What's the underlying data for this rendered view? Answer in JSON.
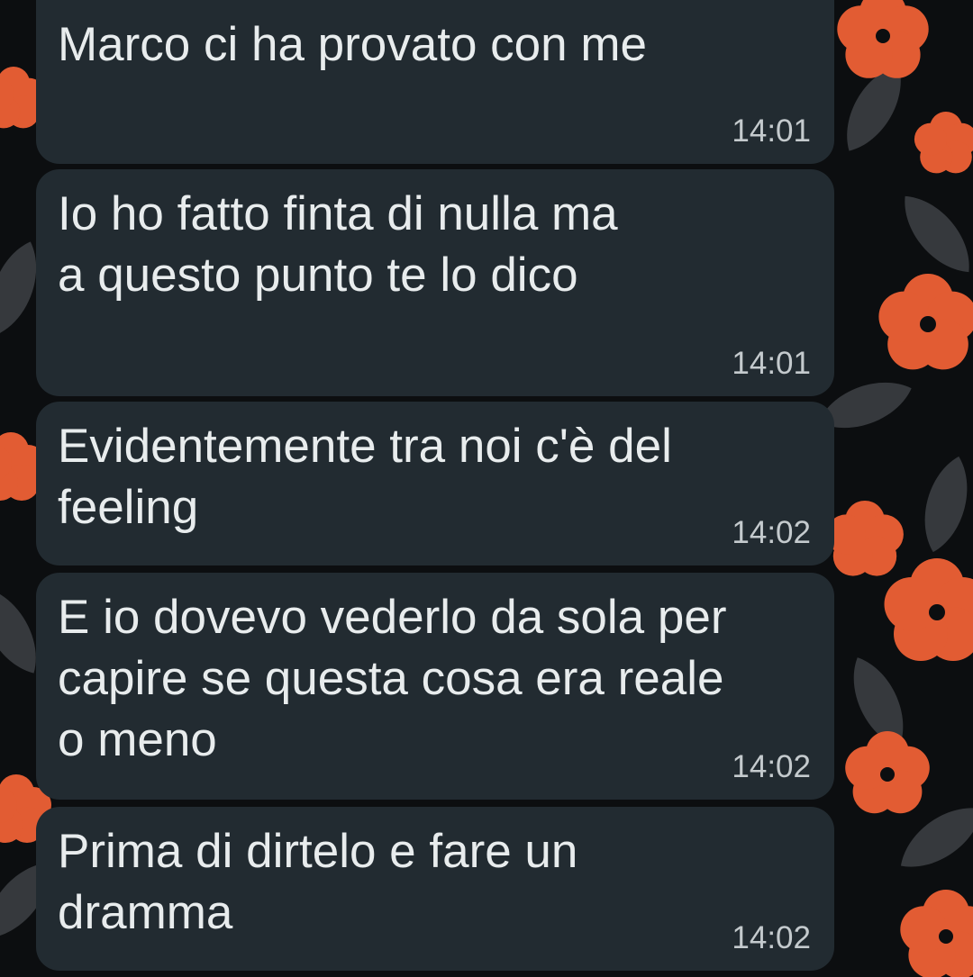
{
  "theme": {
    "bubble_color": "#222b31",
    "text_color": "#e8eced",
    "time_color": "#c4cacd",
    "wallpaper_flower_color": "#e25c33",
    "wallpaper_leaf_color": "#3c3f43"
  },
  "messages": [
    {
      "text": "Marco ci ha provato con me",
      "time": "14:01"
    },
    {
      "text": "Io ho fatto finta di nulla ma\na questo punto te lo dico",
      "time": "14:01"
    },
    {
      "text": "Evidentemente tra noi c'è del\nfeeling",
      "time": "14:02"
    },
    {
      "text": "E io dovevo vederlo da sola per\ncapire se questa cosa era reale\no meno",
      "time": "14:02"
    },
    {
      "text": "Prima di dirtelo e fare un\ndramma",
      "time": "14:02"
    }
  ]
}
